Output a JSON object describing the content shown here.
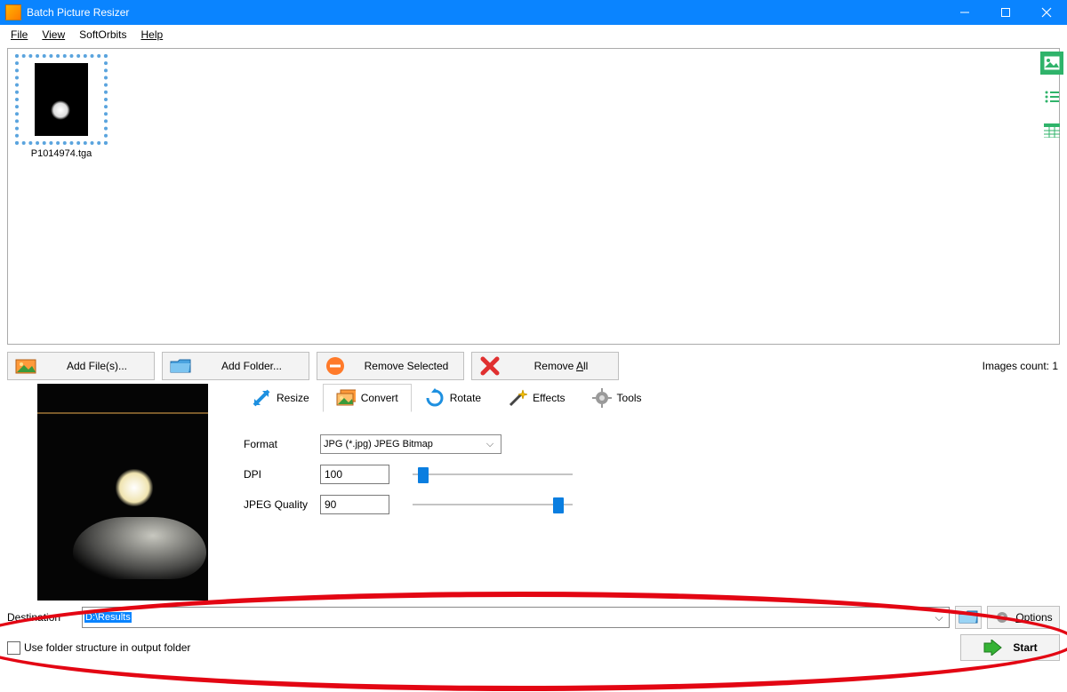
{
  "titlebar": {
    "title": "Batch Picture Resizer"
  },
  "menu": {
    "file": "File",
    "view": "View",
    "softorbits": "SoftOrbits",
    "help": "Help"
  },
  "filelist": {
    "items": [
      {
        "name": "P1014974.tga"
      }
    ]
  },
  "actions": {
    "add_files": "Add File(s)...",
    "add_folder": "Add Folder...",
    "remove_selected": "Remove Selected",
    "remove_all_prefix": "Remove ",
    "remove_all_u": "A",
    "remove_all_suffix": "ll",
    "count_label": "Images count: 1"
  },
  "tabs": {
    "resize": "Resize",
    "convert": "Convert",
    "rotate": "Rotate",
    "effects": "Effects",
    "tools": "Tools"
  },
  "convert": {
    "format_label": "Format",
    "format_value": "JPG (*.jpg) JPEG Bitmap",
    "dpi_label": "DPI",
    "dpi_value": "100",
    "quality_label": "JPEG Quality",
    "quality_value": "90"
  },
  "destination": {
    "label": "Destination",
    "value": "D:\\Results",
    "options_prefix": "O",
    "options_suffix": "ptions"
  },
  "bottom": {
    "use_folder_structure": "Use folder structure in output folder",
    "start": "Start"
  }
}
